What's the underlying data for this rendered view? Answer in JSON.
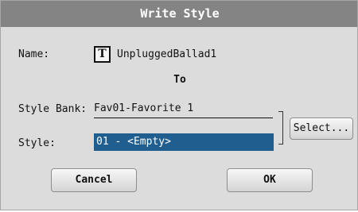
{
  "dialog": {
    "title": "Write Style",
    "name_label": "Name:",
    "name_value": "UnpluggedBallad1",
    "text_icon_glyph": "T",
    "to_label": "To",
    "style_bank_label": "Style Bank:",
    "style_bank_value": "Fav01-Favorite 1",
    "style_label": "Style:",
    "style_value": "01 - <Empty>",
    "select_button": "Select...",
    "cancel_button": "Cancel",
    "ok_button": "OK"
  },
  "colors": {
    "title_bar": "#848484",
    "dialog_bg": "#dcdcdc",
    "selected_field": "#1f5e8f"
  }
}
